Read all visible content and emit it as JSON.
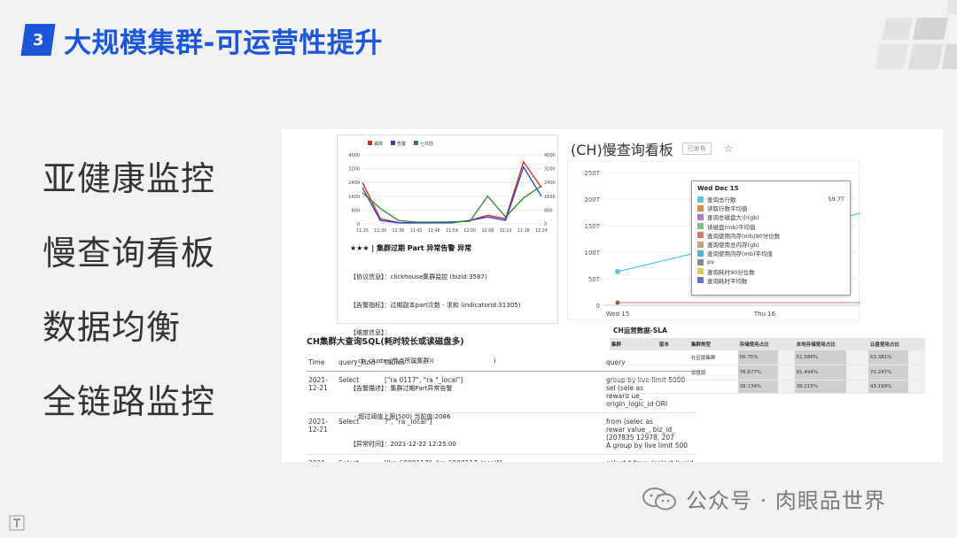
{
  "slide": {
    "number": "3",
    "title": "大规模集群-可运营性提升"
  },
  "nav": [
    {
      "label": "亚健康监控"
    },
    {
      "label": "慢查询看板"
    },
    {
      "label": "数据均衡"
    },
    {
      "label": "全链路监控"
    }
  ],
  "alert_chart": {
    "legend": [
      "丢阵",
      "告警",
      "七日前"
    ],
    "title": "★★★ | 集群过期 Part 异常告警 异常",
    "lines": [
      "【协议信息】：clickhouse集群监控 (bizid:3587)",
      "【告警指标】：过期副本part次数 - 求和 (indicatorid:31305)",
      "【维度信息】：",
      "  - ch_cluster(节点所属集群)(                              )",
      "【告警描述】：集群过期Part异常告警",
      "  - 超过阈值上限(500) 当前值:2086",
      "【异常时间】：2021-12-22 12:25:00"
    ],
    "colors": {
      "red": "#e4221b",
      "blue": "#1f3fe0",
      "green": "#2a8a2a"
    }
  },
  "chart_data": {
    "type": "line",
    "x": [
      "11:25",
      "11:30",
      "11:36",
      "11:42",
      "11:48",
      "11:54",
      "12:00",
      "12:06",
      "12:12",
      "12:18",
      "12:24"
    ],
    "ylim": [
      0,
      4000
    ],
    "yticks": [
      "4000",
      "3200",
      "2400",
      "1600",
      "800",
      "0"
    ],
    "series": [
      {
        "name": "丢阵",
        "color": "#e4221b",
        "values": [
          2400,
          300,
          80,
          60,
          60,
          70,
          200,
          500,
          300,
          3600,
          2100
        ]
      },
      {
        "name": "告警",
        "color": "#1f3fe0",
        "values": [
          2100,
          200,
          60,
          50,
          60,
          60,
          200,
          400,
          200,
          3300,
          1600
        ]
      },
      {
        "name": "七日前",
        "color": "#2a8a2a",
        "values": [
          1800,
          900,
          200,
          100,
          100,
          120,
          150,
          1600,
          400,
          1500,
          2200
        ]
      }
    ]
  },
  "slow_query": {
    "title": "(CH)慢查询看板",
    "tag": "已发布",
    "star": "☆",
    "yticks": [
      "250T",
      "200T",
      "150T",
      "100T",
      "50T",
      "0"
    ],
    "xticks": [
      "Wed 15",
      "Thu 16"
    ],
    "tooltip": {
      "date": "Wed Dec 15",
      "rows": [
        {
          "label": "查询总行数",
          "value": "59.7T",
          "color": "#54c8e0"
        },
        {
          "label": "读取行数平均值",
          "value": "",
          "color": "#e88a3c"
        },
        {
          "label": "查询总磁盘大小(gb)",
          "value": "",
          "color": "#b07ac7"
        },
        {
          "label": "读磁盘(mb)平均值",
          "value": "",
          "color": "#7ec27c"
        },
        {
          "label": "查询使用内存(mb)90分位数",
          "value": "",
          "color": "#e0706a"
        },
        {
          "label": "查询使用总内存(gb)",
          "value": "",
          "color": "#c9a07a"
        },
        {
          "label": "查询使用内存(mb)平均值",
          "value": "",
          "color": "#4bb4d8"
        },
        {
          "label": "pv",
          "value": "",
          "color": "#8a8a8a"
        },
        {
          "label": "查询耗时90分位数",
          "value": "",
          "color": "#e8c84a"
        },
        {
          "label": "查询耗时平均数",
          "value": "",
          "color": "#6a6fc7"
        }
      ]
    }
  },
  "big_query": {
    "title": "CH集群大查询SQL(耗时较长或读磁盘多)",
    "columns": [
      "Time",
      "query_kind",
      "tables",
      "query"
    ],
    "rows": [
      {
        "time": "2021-\n12-21",
        "kind": "Select",
        "tables": "[\"ra      0117\", \"ra        \"_local\"]",
        "query": "group by live  limit 5000\nsel      (sele       as\nreward      ue_      \norigin_logic_id      ORI"
      },
      {
        "time": "2021-\n12-21",
        "kind": "Select",
        "tables": "     ?\", \"ra        _local\"]",
        "query": "    from (selec       as\nrewar      value_, biz_id_\n(207835      12978, 207\nA group by live  limit 500"
      },
      {
        "time": "2021-",
        "kind": "Select",
        "tables": "[\"ra      6000117\", \"ra      6000117_local\"]",
        "query": "select * from (select liveid  as"
      }
    ]
  },
  "sla": {
    "title": "CH运营数据-SLA",
    "left_columns": [
      "集群",
      "版本"
    ],
    "columns": [
      "集群类型",
      "存储使用占比",
      "本地存储使用占比",
      "云盘使用占比"
    ],
    "rows": [
      {
        "type": "社区版集群",
        "a": "56.75%",
        "b": "51.586%",
        "c": "63.381%"
      },
      {
        "type": "云盘版",
        "a": "76.677%",
        "b": "81.494%",
        "c": "70.247%"
      },
      {
        "type": "",
        "a": "38.134%",
        "b": "39.215%",
        "c": "43.199%"
      }
    ]
  },
  "watermark": {
    "text": "公众号 · 肉眼品世界"
  }
}
